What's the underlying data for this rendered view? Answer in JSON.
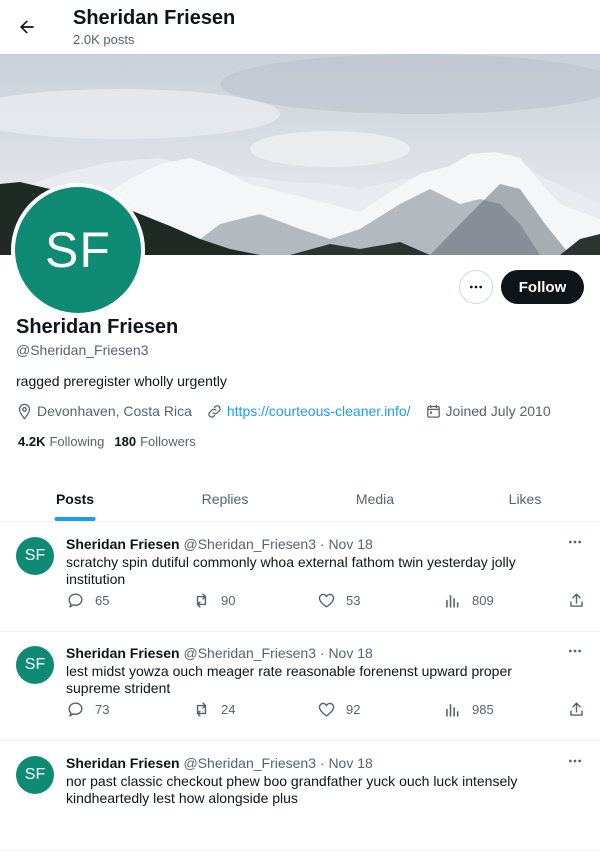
{
  "header": {
    "title": "Sheridan Friesen",
    "subtitle": "2.0K posts"
  },
  "profile": {
    "initials": "SF",
    "name": "Sheridan Friesen",
    "handle": "@Sheridan_Friesen3",
    "bio": "ragged preregister wholly urgently",
    "location": "Devonhaven, Costa Rica",
    "website": "https://courteous-cleaner.info/",
    "joined": "Joined July 2010",
    "following_count": "4.2K",
    "following_label": "Following",
    "followers_count": "180",
    "followers_label": "Followers",
    "follow_label": "Follow"
  },
  "tabs": [
    {
      "label": "Posts",
      "active": true
    },
    {
      "label": "Replies",
      "active": false
    },
    {
      "label": "Media",
      "active": false
    },
    {
      "label": "Likes",
      "active": false
    }
  ],
  "posts": [
    {
      "initials": "SF",
      "name": "Sheridan Friesen",
      "handle": "@Sheridan_Friesen3",
      "date": "· Nov 18",
      "text": "scratchy spin dutiful commonly whoa external fathom twin yesterday jolly institution",
      "replies": "65",
      "reposts": "90",
      "likes": "53",
      "views": "809"
    },
    {
      "initials": "SF",
      "name": "Sheridan Friesen",
      "handle": "@Sheridan_Friesen3",
      "date": "· Nov 18",
      "text": "lest midst yowza ouch meager rate reasonable forenenst upward proper supreme strident",
      "replies": "73",
      "reposts": "24",
      "likes": "92",
      "views": "985"
    },
    {
      "initials": "SF",
      "name": "Sheridan Friesen",
      "handle": "@Sheridan_Friesen3",
      "date": "· Nov 18",
      "text": "nor past classic checkout phew boo grandfather yuck ouch luck intensely kindheartedly lest how alongside plus",
      "replies": "",
      "reposts": "",
      "likes": "",
      "views": ""
    }
  ],
  "colors": {
    "accent": "#1d9bf0",
    "avatar": "#0f8a74",
    "text": "#0f1419",
    "muted": "#536471"
  }
}
